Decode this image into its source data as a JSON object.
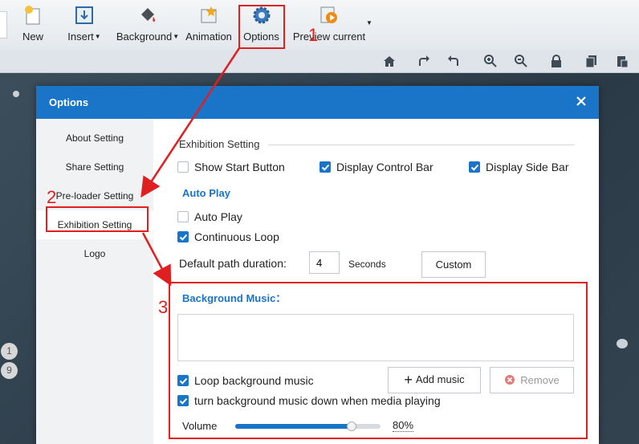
{
  "toolbar": {
    "new": "New",
    "insert": "Insert",
    "background": "Background",
    "animation": "Animation",
    "options": "Options",
    "preview": "Preview current"
  },
  "subbar_icons": [
    "home-icon",
    "redo-icon",
    "undo-icon",
    "zoom-in-icon",
    "zoom-out-icon",
    "lock-icon",
    "copy-icon",
    "paste-icon"
  ],
  "canvas": {
    "page_dots": [
      "1",
      "9"
    ]
  },
  "dialog": {
    "title": "Options",
    "sidebar": [
      {
        "label": "About Setting",
        "active": false
      },
      {
        "label": "Share Setting",
        "active": false
      },
      {
        "label": "Pre-loader Setting",
        "active": false
      },
      {
        "label": "Exhibition Setting",
        "active": true
      },
      {
        "label": "Logo",
        "active": false
      }
    ],
    "exhibition": {
      "section_title": "Exhibition Setting",
      "show_start_button": {
        "label": "Show Start Button",
        "checked": false
      },
      "display_control_bar": {
        "label": "Display Control Bar",
        "checked": true
      },
      "display_side_bar": {
        "label": "Display Side Bar",
        "checked": true
      },
      "auto_play_heading": "Auto Play",
      "auto_play": {
        "label": "Auto Play",
        "checked": false
      },
      "continuous_loop": {
        "label": "Continuous Loop",
        "checked": true
      },
      "path_duration_label": "Default path duration:",
      "path_duration_value": "4",
      "seconds_label": "Seconds",
      "custom_button": "Custom",
      "bg_music_heading": "Background Music：",
      "loop_bg_music": {
        "label": "Loop background music",
        "checked": true
      },
      "turn_down_music": {
        "label": "turn background music down when media playing",
        "checked": true
      },
      "add_music_button": "Add music",
      "remove_button": "Remove",
      "volume_label": "Volume",
      "volume_value": 0.8,
      "volume_text": "80%"
    }
  },
  "annotations": {
    "step1": "1",
    "step2": "2",
    "step3": "3"
  },
  "colors": {
    "accent": "#1a74c7",
    "annotation": "#e02020"
  }
}
